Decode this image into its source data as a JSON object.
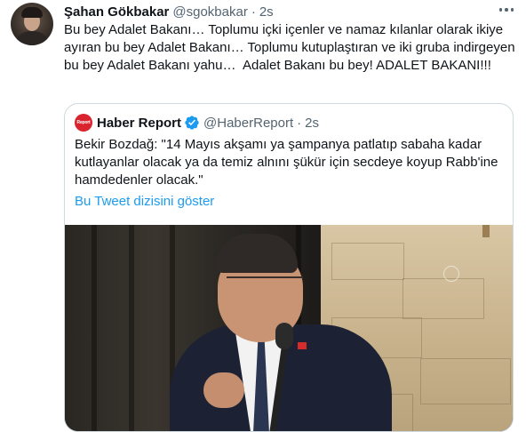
{
  "tweet": {
    "author_name": "Şahan Gökbakar",
    "author_handle": "@sgokbakar",
    "separator": "·",
    "time": "2s",
    "text": "Bu bey Adalet Bakanı… Toplumu içki içenler ve namaz kılanlar olarak ikiye ayıran bu bey Adalet Bakanı… Toplumu kutuplaştıran ve iki gruba indirgeyen bu bey Adalet Bakanı yahu…  Adalet Bakanı bu bey! ADALET BAKANI!!!"
  },
  "quoted_tweet": {
    "author_name": "Haber Report",
    "author_handle": "@HaberReport",
    "separator": "·",
    "time": "2s",
    "avatar_text": "Report",
    "text": "Bekir Bozdağ: \"14 Mayıs akşamı ya şampanya patlatıp sabaha kadar kutlayanlar olacak ya da temiz alnını şükür için secdeye koyup Rabb'ine hamdedenler olacak.\"",
    "thread_link": "Bu Tweet dizisini göster"
  },
  "icons": {
    "more": "more-horizontal-icon",
    "verified": "verified-badge-icon"
  },
  "colors": {
    "link": "#1d9bf0",
    "secondary_text": "#536471",
    "verified": "#1d9bf0",
    "quote_avatar": "#d9232e"
  }
}
